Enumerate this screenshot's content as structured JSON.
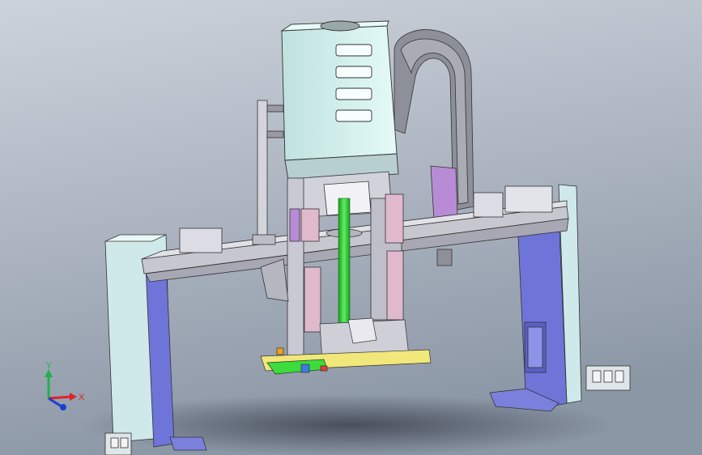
{
  "viewport": {
    "background_top": "#cdd3dc",
    "background_bottom": "#8c97a6"
  },
  "triad": {
    "x_label": "X",
    "y_label": "Y",
    "x_color": "#e0202a",
    "y_color": "#22b24a",
    "z_color": "#1d3fd0"
  },
  "colors": {
    "motor_housing": "#cfeeea",
    "frame_column_light": "#cfe9ea",
    "frame_column_blue": "#6e74d8",
    "beam": "#c7c7d0",
    "cable_carrier": "#8d8f99",
    "guide_pink": "#e0b9cc",
    "accent_purple": "#b78bd6",
    "shaft_green": "#3bdc3b",
    "gripper_yellow": "#f1e77a"
  },
  "icons": [
    "view-triad-icon"
  ]
}
